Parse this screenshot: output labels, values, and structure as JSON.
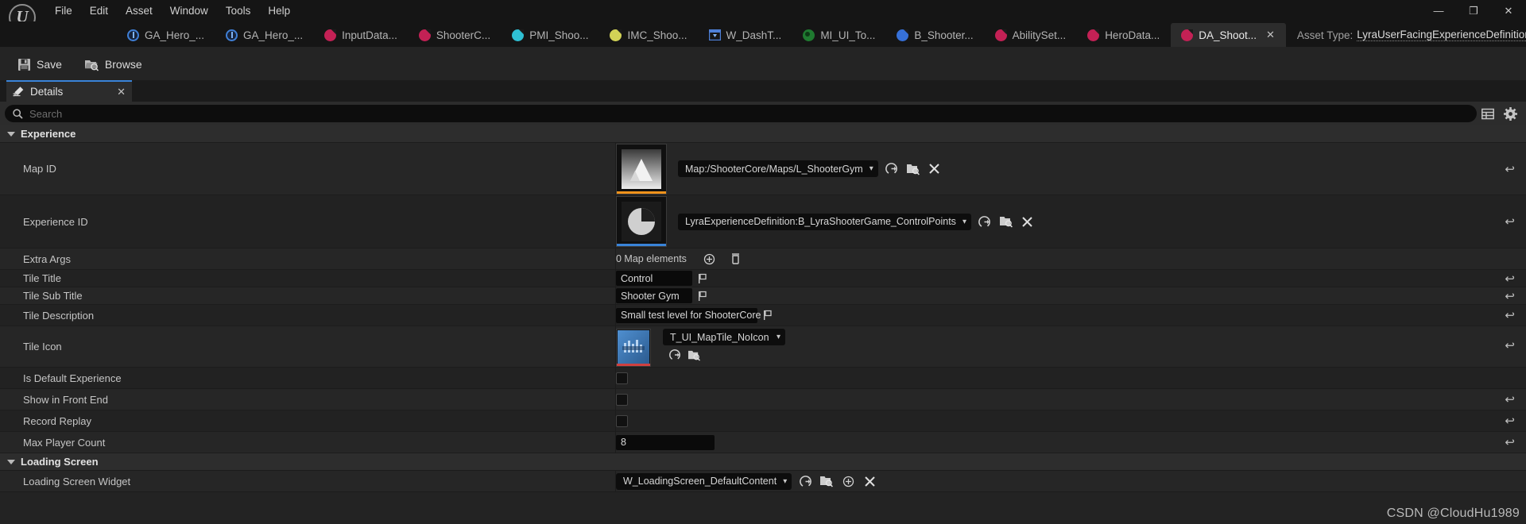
{
  "window": {
    "app": "Unreal Editor",
    "logo_glyph": "U",
    "controls": {
      "minimize": "—",
      "maximize": "❐",
      "close": "✕"
    }
  },
  "menubar": {
    "items": [
      "File",
      "Edit",
      "Asset",
      "Window",
      "Tools",
      "Help"
    ]
  },
  "tabs": [
    {
      "label": "GA_Hero_...",
      "icon": "blueprint-icon",
      "color": "#3f7fd6",
      "active": false
    },
    {
      "label": "GA_Hero_...",
      "icon": "blueprint-icon",
      "color": "#3f7fd6",
      "active": false
    },
    {
      "label": "InputData...",
      "icon": "data-asset-icon",
      "color": "#c32155",
      "active": false
    },
    {
      "label": "ShooterC...",
      "icon": "data-asset-icon",
      "color": "#c32155",
      "active": false
    },
    {
      "label": "PMI_Shoo...",
      "icon": "data-asset-icon",
      "color": "#2fc0d4",
      "active": false
    },
    {
      "label": "IMC_Shoo...",
      "icon": "data-asset-icon",
      "color": "#d2d356",
      "active": false
    },
    {
      "label": "W_DashT...",
      "icon": "widget-icon",
      "color": "#4d7fd6",
      "active": false
    },
    {
      "label": "MI_UI_To...",
      "icon": "material-icon",
      "color": "#1f7a30",
      "active": false
    },
    {
      "label": "B_Shooter...",
      "icon": "data-asset-icon",
      "color": "#3670d8",
      "active": false
    },
    {
      "label": "AbilitySet...",
      "icon": "data-asset-icon",
      "color": "#c32155",
      "active": false
    },
    {
      "label": "HeroData...",
      "icon": "data-asset-icon",
      "color": "#c32155",
      "active": false
    },
    {
      "label": "DA_Shoot...",
      "icon": "data-asset-icon",
      "color": "#c32155",
      "active": true,
      "close": "✕"
    }
  ],
  "asset_type": {
    "label": "Asset Type:",
    "value": "LyraUserFacingExperienceDefinition"
  },
  "toolbar": {
    "save_label": "Save",
    "browse_label": "Browse",
    "save_icon": "save-disk-icon",
    "browse_icon": "browse-folder-icon"
  },
  "details_panel": {
    "tab_label": "Details",
    "tab_icon": "details-pencil-icon",
    "tab_close": "✕",
    "search": {
      "placeholder": "Search",
      "value": "",
      "icon": "search-icon"
    },
    "view_options_icon": "columns-icon",
    "settings_icon": "gear-icon"
  },
  "categories": [
    {
      "name": "Experience",
      "expanded": true
    },
    {
      "name": "Loading Screen",
      "expanded": true
    }
  ],
  "properties": {
    "map_id": {
      "label": "Map ID",
      "value": "Map:/ShooterCore/Maps/L_ShooterGym",
      "thumb_icon": "map-mountain-thumbnail",
      "thumb_underline_color": "#f0921b",
      "buttons": [
        "browse-to-asset-icon",
        "use-selected-asset-icon",
        "clear-asset-icon"
      ],
      "reset_icon": "reset-arrow-icon"
    },
    "experience_id": {
      "label": "Experience ID",
      "value": "LyraExperienceDefinition:B_LyraShooterGame_ControlPoints",
      "thumb_icon": "data-asset-pie-thumbnail",
      "thumb_underline_color": "#3983d8",
      "buttons": [
        "browse-to-asset-icon",
        "use-selected-asset-icon",
        "clear-asset-icon"
      ],
      "reset_icon": "reset-arrow-icon"
    },
    "extra_args": {
      "label": "Extra Args",
      "value": "0 Map elements",
      "buttons": [
        "add-element-icon",
        "delete-all-elements-icon"
      ]
    },
    "tile_title": {
      "label": "Tile Title",
      "value": "Control",
      "flag_icon": "localization-flag-icon",
      "reset_icon": "reset-arrow-icon"
    },
    "tile_sub_title": {
      "label": "Tile Sub Title",
      "value": "Shooter Gym",
      "flag_icon": "localization-flag-icon",
      "reset_icon": "reset-arrow-icon"
    },
    "tile_description": {
      "label": "Tile Description",
      "value": "Small test level for ShooterCore",
      "flag_icon": "localization-flag-icon",
      "reset_icon": "reset-arrow-icon"
    },
    "tile_icon": {
      "label": "Tile Icon",
      "value": "T_UI_MapTile_NoIcon",
      "thumb_icon": "texture-thumbnail",
      "thumb_underline_color": "#cf4040",
      "buttons": [
        "browse-to-asset-icon",
        "use-selected-asset-icon"
      ],
      "reset_icon": "reset-arrow-icon"
    },
    "is_default_experience": {
      "label": "Is Default Experience",
      "checked": false
    },
    "show_in_front_end": {
      "label": "Show in Front End",
      "checked": false,
      "reset_icon": "reset-arrow-icon"
    },
    "record_replay": {
      "label": "Record Replay",
      "checked": false,
      "reset_icon": "reset-arrow-icon"
    },
    "max_player_count": {
      "label": "Max Player Count",
      "value": "8",
      "reset_icon": "reset-arrow-icon"
    },
    "loading_screen_widget": {
      "label": "Loading Screen Widget",
      "value": "W_LoadingScreen_DefaultContent",
      "buttons": [
        "browse-to-asset-icon",
        "use-selected-asset-icon",
        "new-asset-icon",
        "clear-asset-icon"
      ]
    }
  },
  "watermark": "CSDN @CloudHu1989"
}
